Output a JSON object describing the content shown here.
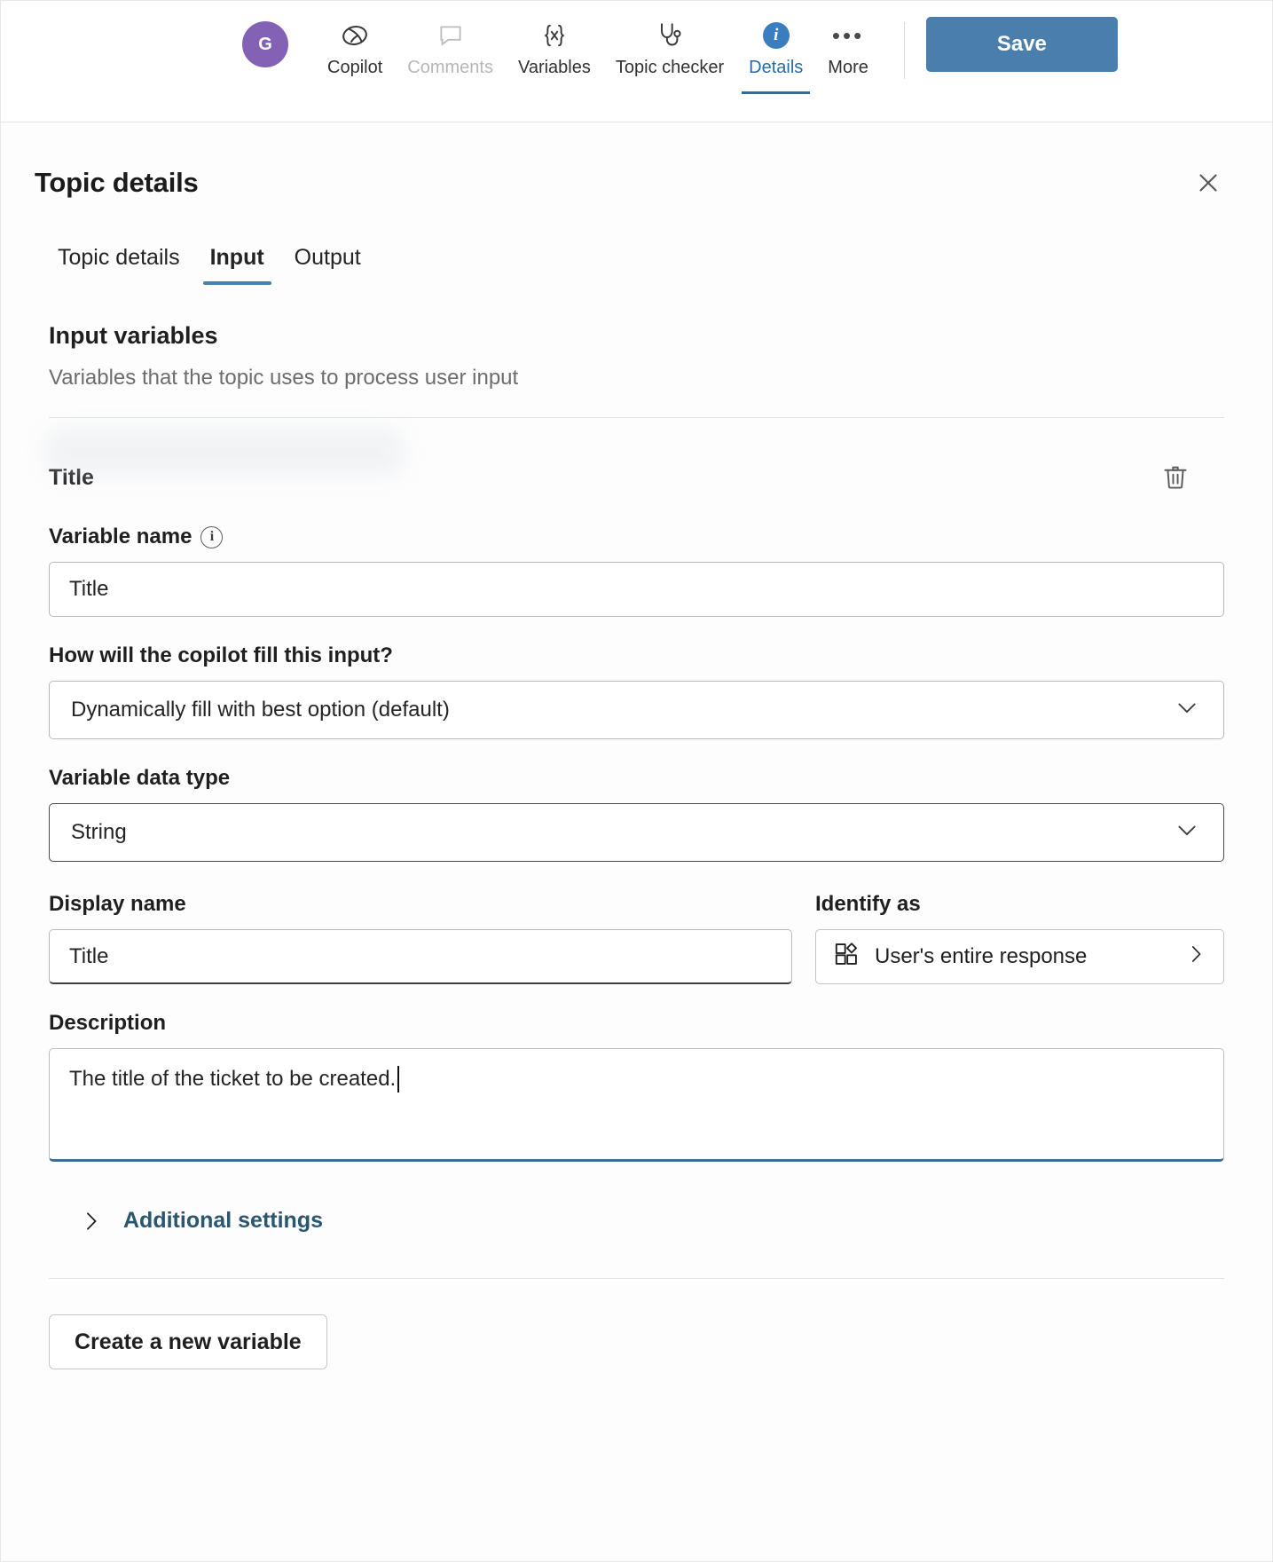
{
  "toolbar": {
    "avatar_initial": "G",
    "avatar_color": "#8362b5",
    "items": [
      {
        "label": "Copilot",
        "icon": "copilot-icon",
        "state": "enabled"
      },
      {
        "label": "Comments",
        "icon": "comment-bubble-icon",
        "state": "disabled"
      },
      {
        "label": "Variables",
        "icon": "variables-braces-icon",
        "state": "enabled"
      },
      {
        "label": "Topic checker",
        "icon": "stethoscope-icon",
        "state": "enabled"
      },
      {
        "label": "Details",
        "icon": "info-circle-icon",
        "state": "active"
      },
      {
        "label": "More",
        "icon": "ellipsis-icon",
        "state": "enabled"
      }
    ],
    "save_label": "Save",
    "save_color": "#4a7ead"
  },
  "panel": {
    "title": "Topic details",
    "close_label": "Close",
    "tabs": [
      {
        "label": "Topic details",
        "selected": false
      },
      {
        "label": "Input",
        "selected": true
      },
      {
        "label": "Output",
        "selected": false
      }
    ],
    "section_heading": "Input variables",
    "section_description": "Variables that the topic uses to process user input"
  },
  "variable": {
    "card_title": "Title",
    "delete_label": "Delete variable",
    "variable_name": {
      "label": "Variable name",
      "info_glyph": "i",
      "value": "Title"
    },
    "fill_method": {
      "label": "How will the copilot fill this input?",
      "value": "Dynamically fill with best option (default)"
    },
    "data_type": {
      "label": "Variable data type",
      "value": "String"
    },
    "display_name": {
      "label": "Display name",
      "value": "Title"
    },
    "identify_as": {
      "label": "Identify as",
      "value": "User's entire response",
      "icon": "entity-squares-icon"
    },
    "description": {
      "label": "Description",
      "value": "The title of the ticket to be created."
    },
    "additional_settings_label": "Additional settings"
  },
  "footer": {
    "create_variable_label": "Create a new variable"
  }
}
